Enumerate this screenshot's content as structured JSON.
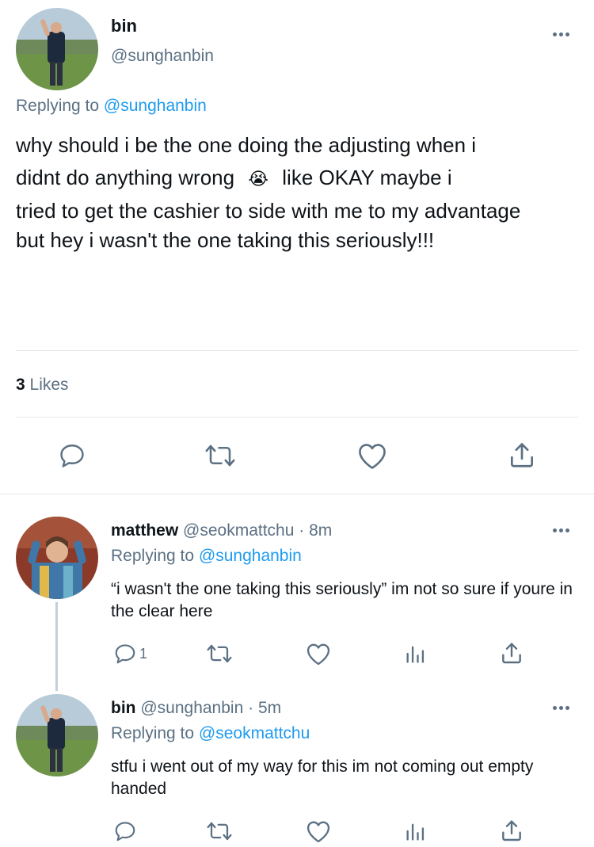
{
  "main_tweet": {
    "display_name": "bin",
    "handle": "@sunghanbin",
    "replying_prefix": "Replying to",
    "replying_to": "@sunghanbin",
    "text_line1": "why should i be the one doing the adjusting when i",
    "text_line2a": "didnt do anything wrong",
    "emoji": "😭",
    "text_line2b": "like OKAY maybe i",
    "text_rest": "tried to get the cashier to side with me to my advantage but hey i wasn't the one taking this seriously!!!",
    "likes_count": "3",
    "likes_label": "Likes"
  },
  "replies": [
    {
      "display_name": "matthew",
      "handle": "@seokmattchu",
      "sep": "·",
      "time": "8m",
      "replying_prefix": "Replying to",
      "replying_to": "@sunghanbin",
      "text": "“i wasn't the one taking this seriously” im not so sure if youre in the clear here",
      "reply_count": "1"
    },
    {
      "display_name": "bin",
      "handle": "@sunghanbin",
      "sep": "·",
      "time": "5m",
      "replying_prefix": "Replying to",
      "replying_to": "@seokmattchu",
      "text": "stfu i went out of my way for this im not coming out empty handed",
      "reply_count": ""
    }
  ],
  "icons": {
    "reply": "reply-icon",
    "retweet": "retweet-icon",
    "like": "heart-icon",
    "share": "share-icon",
    "analytics": "analytics-icon",
    "more": "more-icon"
  },
  "colors": {
    "link": "#1d9bf0",
    "muted": "#5b7083",
    "divider": "#e1e8ed"
  }
}
